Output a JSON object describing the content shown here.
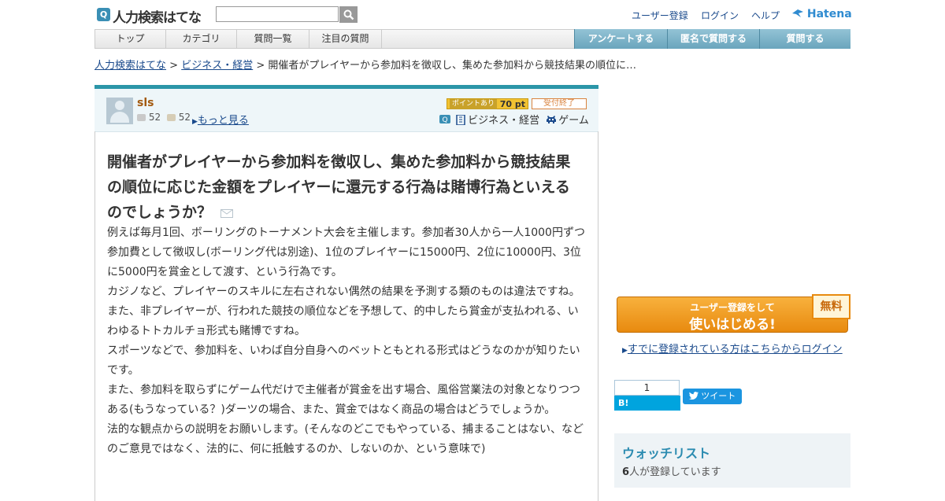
{
  "header": {
    "logo_mark": "Q",
    "logo_text": "人力検索はてな",
    "search_placeholder": "",
    "links": [
      "ユーザー登録",
      "ログイン",
      "ヘルプ"
    ],
    "hatena_logo": "Hatena"
  },
  "nav": {
    "tabs": [
      "トップ",
      "カテゴリ",
      "質問一覧",
      "注目の質問"
    ],
    "actions": [
      "アンケートする",
      "匿名で質問する",
      "質問する"
    ]
  },
  "breadcrumb": {
    "home": "人力検索はてな",
    "category": "ビジネス・経営",
    "current": "開催者がプレイヤーから参加料を徴収し、集めた参加料から競技結果の順位に…",
    "separator": ">"
  },
  "question": {
    "user": {
      "name": "sls",
      "questions": "52",
      "answers": "52",
      "more": "もっと見る"
    },
    "points_label": "ポイントあり",
    "points_value": "70 pt",
    "status": "受付終了",
    "categories": [
      "ビジネス・経営",
      "ゲーム"
    ],
    "title": "開催者がプレイヤーから参加料を徴収し、集めた参加料から競技結果の順位に応じた金額をプレイヤーに還元する行為は賭博行為といえるのでしょうか？",
    "body": [
      "例えば毎月1回、ボーリングのトーナメント大会を主催します。参加者30人から一人1000円ずつ参加費として徴収し(ボーリング代は別途)、1位のプレイヤーに15000円、2位に10000円、3位に5000円を賞金として渡す、という行為です。",
      "カジノなど、プレイヤーのスキルに左右されない偶然の結果を予測する類のものは違法ですね。",
      "また、非プレイヤーが、行われた競技の順位などを予想して、的中したら賞金が支払われる、いわゆるトトカルチョ形式も賭博ですね。",
      "スポーツなどで、参加料を、いわば自分自身へのベットともとれる形式はどうなのかが知りたいです。",
      "また、参加料を取らずにゲーム代だけで主催者が賞金を出す場合、風俗営業法の対象となりつつある(もうなっている？)ダーツの場合、また、賞金ではなく商品の場合はどうでしょうか。",
      "法的な観点からの説明をお願いします。(そんなのどこでもやっている、捕まることはない、などのご意見ではなく、法的に、何に抵触するのか、しないのか、という意味で)"
    ]
  },
  "sidebar": {
    "signup_line1": "ユーザー登録をして",
    "signup_line2": "使いはじめる!",
    "free_badge": "無料",
    "login_link": "すでに登録されている方はこちらからログイン",
    "bookmark_count": "1",
    "bookmark_label": "B! Bookmark",
    "tweet_label": "ツイート",
    "watchlist_title": "ウォッチリスト",
    "watchlist_count": "6",
    "watchlist_text": "人が登録しています"
  },
  "colors": {
    "accent": "#2b96a8",
    "nav_button": "#6aa5bd",
    "signup": "#e88a0f",
    "link": "#1a4a8c"
  }
}
